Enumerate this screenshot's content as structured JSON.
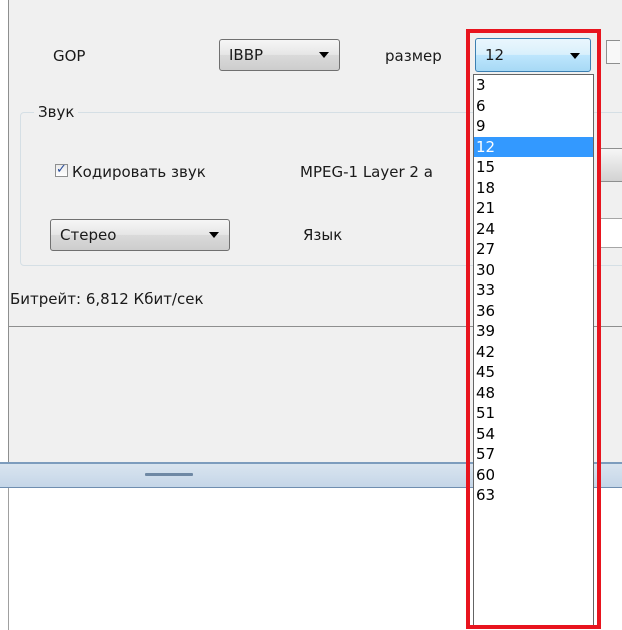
{
  "video": {
    "gop_label": "GOP",
    "gop_value": "IBBP",
    "size_label": "размер",
    "size_value": "12"
  },
  "audio": {
    "group_title": "Звук",
    "encode_checkbox_label": "Кодировать звук",
    "encode_checked": true,
    "codec_value": "MPEG-1 Layer 2 a",
    "channels_value": "Стерео",
    "language_label": "Язык"
  },
  "bitrate_text": "Битрейт: 6,812 Кбит/сек",
  "dropdown": {
    "options": [
      "3",
      "6",
      "9",
      "12",
      "15",
      "18",
      "21",
      "24",
      "27",
      "30",
      "33",
      "36",
      "39",
      "42",
      "45",
      "48",
      "51",
      "54",
      "57",
      "60",
      "63"
    ],
    "selected": "12"
  },
  "colors": {
    "highlight_frame": "#e8141e",
    "selection": "#3399ff",
    "panel_bg": "#f0f0f0"
  }
}
